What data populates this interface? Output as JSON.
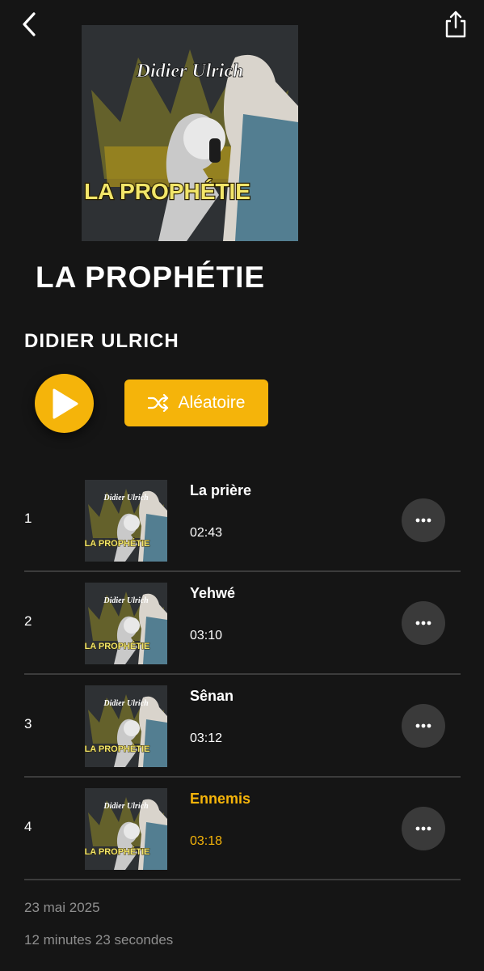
{
  "album": {
    "title": "LA PROPHÉTIE",
    "artist": "DIDIER ULRICH",
    "cover_text_top": "Didier Ulrich",
    "cover_text_bottom": "LA PROPHÉTIE"
  },
  "actions": {
    "shuffle_label": "Aléatoire"
  },
  "tracks": [
    {
      "number": "1",
      "title": "La prière",
      "duration": "02:43",
      "active": false
    },
    {
      "number": "2",
      "title": "Yehwé",
      "duration": "03:10",
      "active": false
    },
    {
      "number": "3",
      "title": "Sênan",
      "duration": "03:12",
      "active": false
    },
    {
      "number": "4",
      "title": "Ennemis",
      "duration": "03:18",
      "active": true
    }
  ],
  "footer": {
    "release_date": "23 mai 2025",
    "total_duration": "12 minutes 23 secondes"
  },
  "colors": {
    "background": "#151515",
    "accent": "#f5b40a",
    "muted_text": "#8f8f8f",
    "more_button": "#3a3a3a"
  },
  "icons": {
    "back": "chevron-left-icon",
    "share": "share-icon",
    "play": "play-icon",
    "shuffle": "shuffle-icon",
    "more": "more-horizontal-icon"
  }
}
